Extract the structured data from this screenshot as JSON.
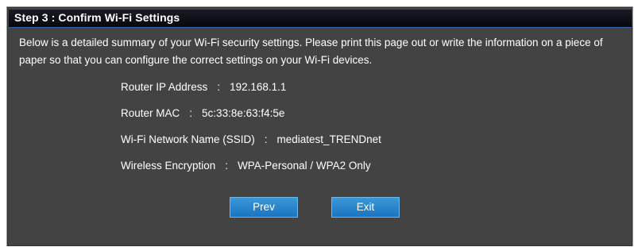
{
  "step_title": "Step 3 : Confirm Wi-Fi Settings",
  "description": "Below is a detailed summary of your Wi-Fi security settings. Please print this page out or write the information on a piece of paper so that you can configure the correct settings on your Wi-Fi devices.",
  "settings": [
    {
      "label": "Router IP Address",
      "separator": ":",
      "value": "192.168.1.1"
    },
    {
      "label": "Router MAC",
      "separator": ":",
      "value": "5c:33:8e:63:f4:5e"
    },
    {
      "label": "Wi-Fi Network Name (SSID)",
      "separator": ":",
      "value": "mediatest_TRENDnet"
    },
    {
      "label": "Wireless Encryption",
      "separator": ":",
      "value": "WPA-Personal / WPA2 Only"
    }
  ],
  "buttons": {
    "prev_label": "Prev",
    "exit_label": "Exit"
  },
  "colors": {
    "panel_bg": "#434343",
    "title_bar": "#0c0c14",
    "button_blue": "#2a86cf",
    "text": "#ffffff"
  }
}
